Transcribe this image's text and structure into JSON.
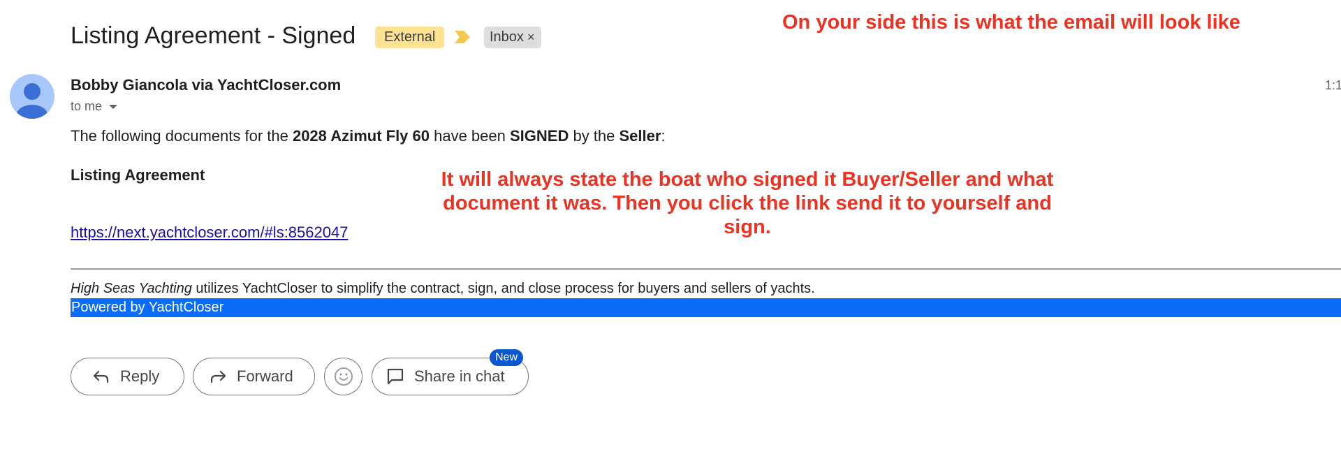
{
  "header": {
    "subject": "Listing Agreement - Signed",
    "external_label": "External",
    "inbox_label": "Inbox",
    "inbox_remove": "×",
    "importance_icon": "importance-marker-icon",
    "external_color": "#fde293"
  },
  "annotations": {
    "top": "On your side this is what the email will look like",
    "mid": "It will always state the boat who signed it Buyer/Seller and what document it was. Then you click the link send it to yourself and sign.",
    "color": "#ea3323"
  },
  "sender": {
    "name": "Bobby Giancola via YachtCloser.com",
    "recipient": "to me",
    "time": "1:1",
    "avatar_icon": "default-avatar-icon"
  },
  "message": {
    "intro_1": "The following documents for the ",
    "boat": "2028 Azimut Fly 60",
    "intro_2": " have been ",
    "status": "SIGNED",
    "intro_3": " by the ",
    "party": "Seller",
    "intro_4": ":",
    "document_title": "Listing Agreement",
    "link": "https://next.yachtcloser.com/#ls:8562047",
    "footer_company": "High Seas Yachting",
    "footer_text": " utilizes YachtCloser to simplify the contract, sign, and close process for buyers and sellers of yachts.",
    "powered_by": "Powered by YachtCloser",
    "powered_color": "#0b6cf5"
  },
  "actions": {
    "reply": "Reply",
    "forward": "Forward",
    "emoji_icon": "emoji-icon",
    "share": "Share in chat",
    "new_badge": "New"
  }
}
